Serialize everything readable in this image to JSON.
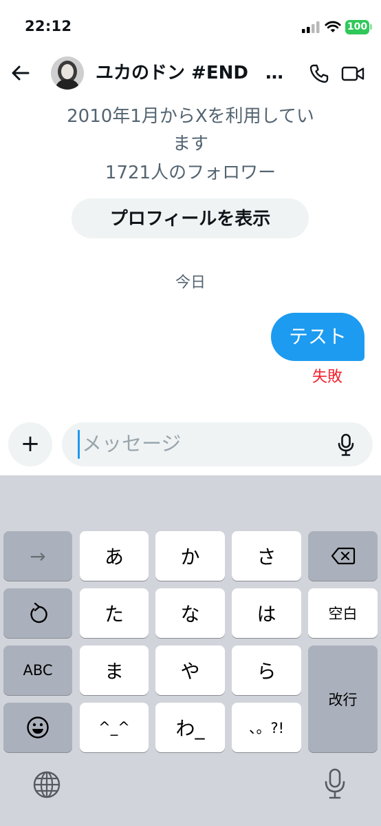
{
  "status_bar": {
    "time": "22:12",
    "battery": "100",
    "colors": {
      "battery": "#30c85a"
    }
  },
  "header": {
    "title": "ユカのドン #END",
    "ellipsis": "…",
    "icons": [
      "back-arrow-icon",
      "avatar",
      "phone-icon",
      "video-camera-icon"
    ]
  },
  "profile_info": {
    "joined_line1": "2010年1月からXを利用してい",
    "joined_line2": "ます",
    "followers": "1721人のフォロワー",
    "view_profile_button": "プロフィールを表示"
  },
  "conversation": {
    "date_separator": "今日",
    "messages": [
      {
        "text": "テスト",
        "status": "失敗",
        "outgoing": true
      }
    ],
    "colors": {
      "bubble": "#1d9bf0",
      "error": "#f4212e"
    }
  },
  "composer": {
    "add_label": "+",
    "placeholder": "メッセージ",
    "icons": [
      "microphone-icon"
    ]
  },
  "keyboard": {
    "keys": {
      "arrow": "→",
      "a": "あ",
      "ka": "か",
      "sa": "さ",
      "ta": "た",
      "na": "な",
      "ha": "は",
      "space": "空白",
      "abc": "ABC",
      "ma": "ま",
      "ya": "や",
      "ra": "ら",
      "enter": "改行",
      "kaomoji": "^_^",
      "wa": "わ_",
      "punct": "、。?!"
    },
    "icons": [
      "delete-backspace-icon",
      "undo-icon",
      "emoji-icon",
      "globe-icon",
      "microphone-icon"
    ]
  }
}
